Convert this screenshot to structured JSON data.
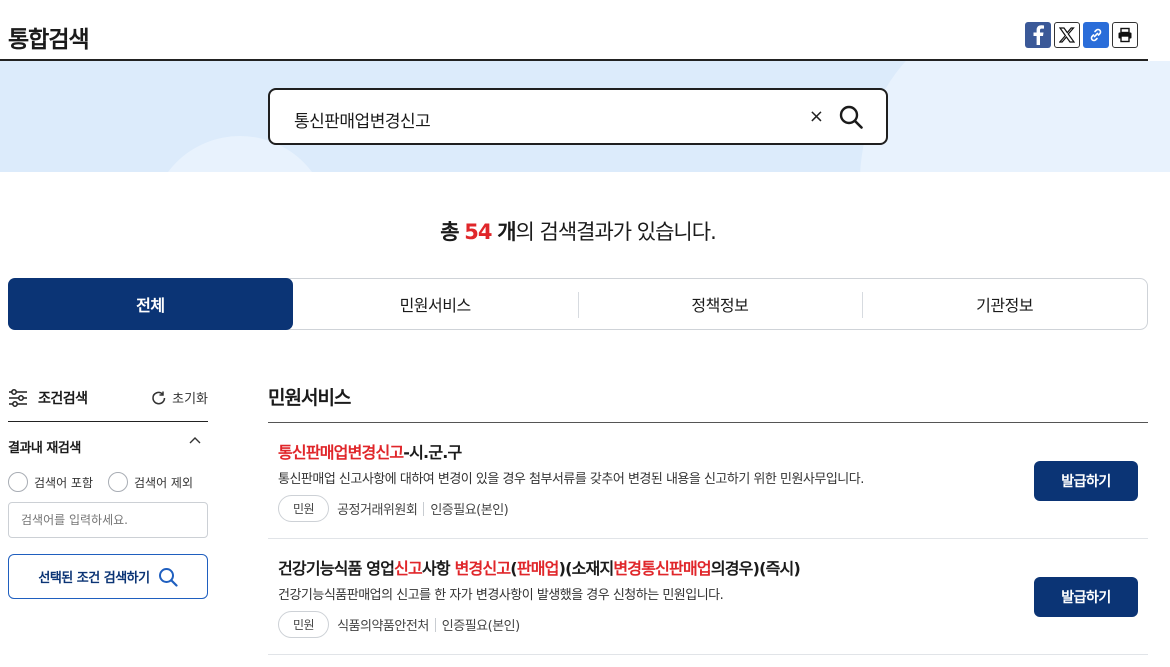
{
  "header": {
    "title": "통합검색"
  },
  "share": {
    "icons": [
      "facebook-icon",
      "x-icon",
      "link-icon",
      "print-icon"
    ]
  },
  "search": {
    "value": "통신판매업변경신고",
    "clear": "×"
  },
  "summary": {
    "prefix": "총",
    "count": "54",
    "unit": "개",
    "suffix": "의 검색결과가 있습니다."
  },
  "tabs": [
    {
      "label": "전체",
      "active": true
    },
    {
      "label": "민원서비스",
      "active": false
    },
    {
      "label": "정책정보",
      "active": false
    },
    {
      "label": "기관정보",
      "active": false
    }
  ],
  "filter": {
    "title": "조건검색",
    "reset": "초기화",
    "refine_label": "결과내 재검색",
    "option_include": "검색어 포함",
    "option_exclude": "검색어 제외",
    "placeholder": "검색어를 입력하세요.",
    "submit": "선택된 조건 검색하기"
  },
  "section": {
    "title": "민원서비스"
  },
  "results": [
    {
      "title_parts": [
        {
          "text": "통신판매업변경신고",
          "hl": true
        },
        {
          "text": "-시.군.구",
          "hl": false
        }
      ],
      "desc": "통신판매업 신고사항에 대하여 변경이 있을 경우 첨부서류를 갖추어 변경된 내용을 신고하기 위한 민원사무입니다.",
      "chip": "민원",
      "agency": "공정거래위원회",
      "auth": "인증필요(본인)",
      "button": "발급하기"
    },
    {
      "title_parts": [
        {
          "text": "건강기능식품 영업",
          "hl": false
        },
        {
          "text": "신고",
          "hl": true
        },
        {
          "text": "사항 ",
          "hl": false
        },
        {
          "text": "변경신고",
          "hl": true
        },
        {
          "text": "(",
          "hl": false
        },
        {
          "text": "판매업",
          "hl": true
        },
        {
          "text": ")(소재지",
          "hl": false
        },
        {
          "text": "변경통신판매업",
          "hl": true
        },
        {
          "text": "의경우)(즉시)",
          "hl": false
        }
      ],
      "desc": "건강기능식품판매업의 신고를 한 자가 변경사항이 발생했을 경우 신청하는 민원입니다.",
      "chip": "민원",
      "agency": "식품의약품안전처",
      "auth": "인증필요(본인)",
      "button": "발급하기"
    }
  ]
}
